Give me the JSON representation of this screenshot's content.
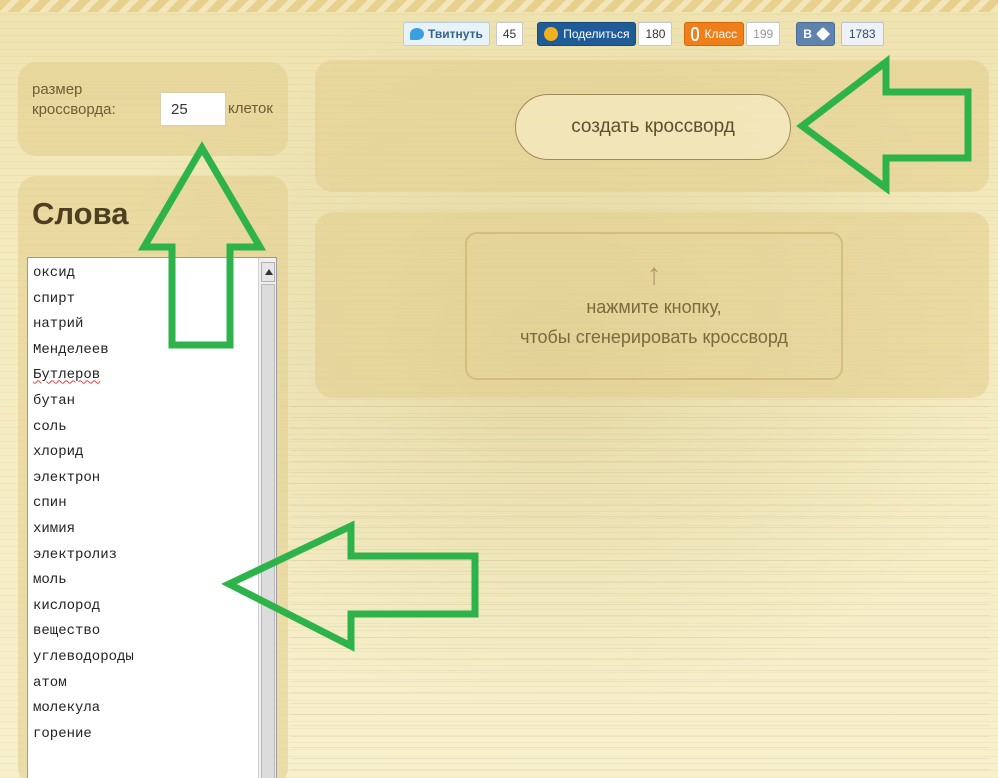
{
  "social": {
    "twitter_label": "Твитнуть",
    "twitter_count": "45",
    "share_label": "Поделиться",
    "share_count": "180",
    "ok_label": "Класс",
    "ok_count": "199",
    "vk_label": "В",
    "vk_count": "1783"
  },
  "size": {
    "label": "размер кроссворда:",
    "value": "25",
    "unit": "клеток"
  },
  "words": {
    "title": "Слова",
    "items": [
      "оксид",
      "спирт",
      "натрий",
      "Менделеев",
      "Бутлеров",
      "бутан",
      "соль",
      "хлорид",
      "электрон",
      "спин",
      "химия",
      "электролиз",
      "моль",
      "кислород",
      "вещество",
      "углеводороды",
      "атом",
      "молекула",
      "горение"
    ]
  },
  "create": {
    "button_label": "создать кроссворд"
  },
  "hint": {
    "arrow": "↑",
    "line1": "нажмите кнопку,",
    "line2": "чтобы сгенерировать кроссворд"
  },
  "colors": {
    "arrow_green": "#2db34a",
    "panel": "#e2cd8c",
    "background": "#f6eec2"
  }
}
